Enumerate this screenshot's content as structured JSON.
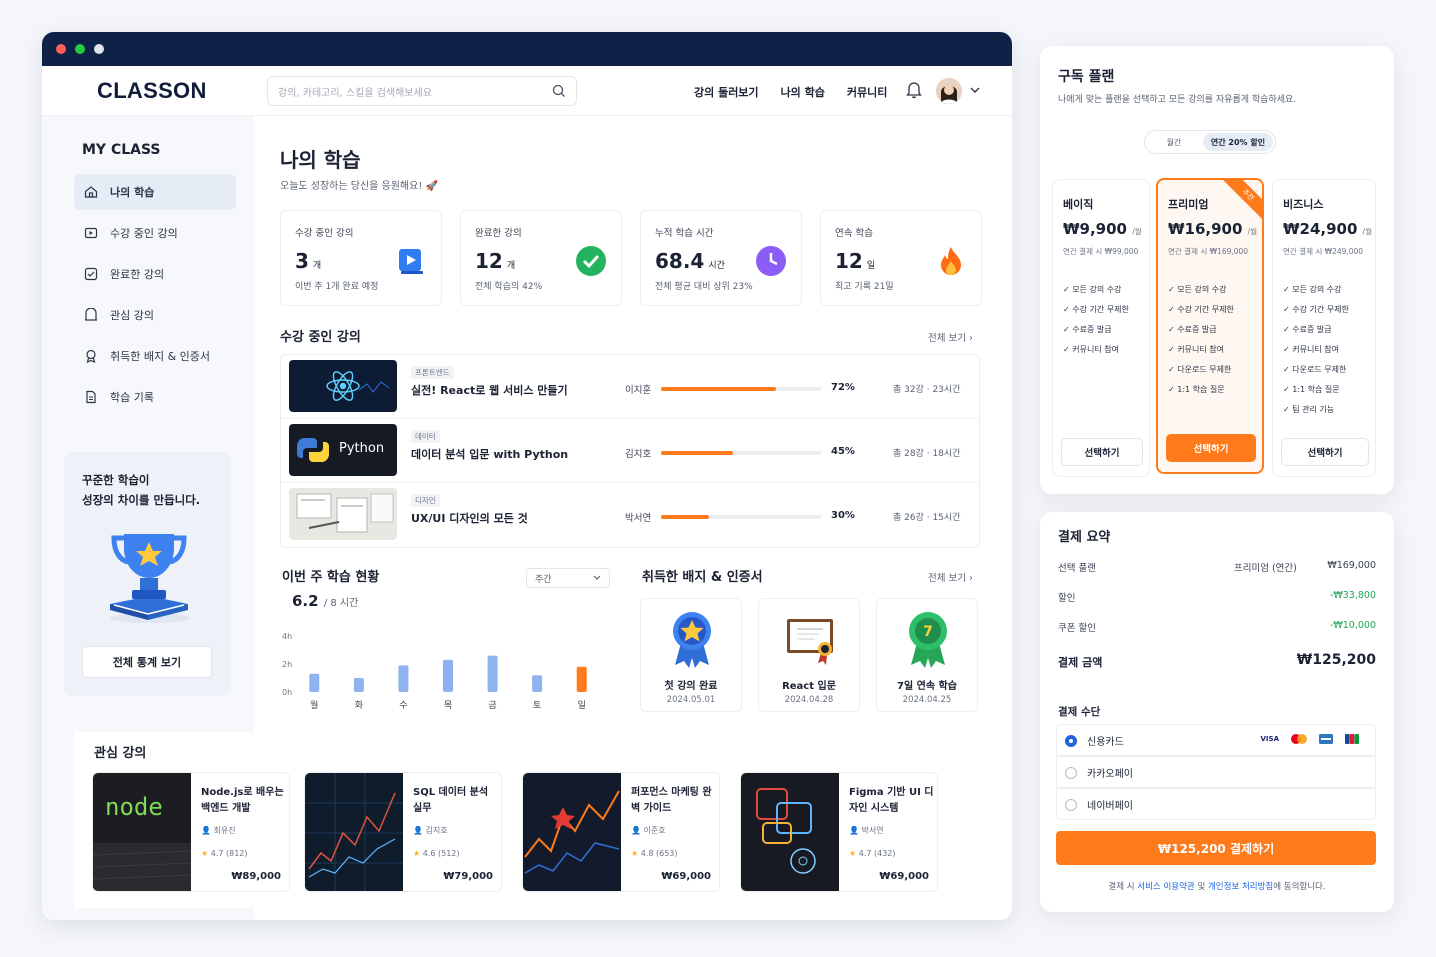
{
  "header": {
    "logo": "CLASSON",
    "search_placeholder": "강의, 카테고리, 스킬을 검색해보세요",
    "nav": [
      "강의 둘러보기",
      "나의 학습",
      "커뮤니티"
    ]
  },
  "sidebar": {
    "title": "MY CLASS",
    "items": [
      {
        "label": "나의 학습",
        "icon": "home-icon"
      },
      {
        "label": "수강 중인 강의",
        "icon": "play-icon"
      },
      {
        "label": "완료한 강의",
        "icon": "check-square-icon"
      },
      {
        "label": "관심 강의",
        "icon": "bookmark-icon"
      },
      {
        "label": "취득한 배지 & 인증서",
        "icon": "badge-icon"
      },
      {
        "label": "학습 기록",
        "icon": "document-icon"
      }
    ],
    "promo": {
      "line1": "꾸준한 학습이",
      "line2": "성장의 차이를 만듭니다.",
      "button": "전체 통계 보기"
    }
  },
  "main": {
    "title": "나의 학습",
    "subtitle": "오늘도 성장하는 당신을 응원해요! 🚀",
    "stats": [
      {
        "label": "수강 중인 강의",
        "value": "3",
        "unit": "개",
        "sub": "이번 주 1개 완료 예정"
      },
      {
        "label": "완료한 강의",
        "value": "12",
        "unit": "개",
        "sub": "전체 학습의 42%"
      },
      {
        "label": "누적 학습 시간",
        "value": "68.4",
        "unit": "시간",
        "sub": "전체 평균 대비 상위 23%"
      },
      {
        "label": "연속 학습",
        "value": "12",
        "unit": "일",
        "sub": "최고 기록 21일"
      }
    ],
    "courses_title": "수강 중인 강의",
    "see_all": "전체 보기",
    "courses": [
      {
        "category": "프론트엔드",
        "name": "실전! React로 웹 서비스 만들기",
        "instructor": "이지훈",
        "progress": 72,
        "progress_label": "72%",
        "total": "총 32강 · 23시간"
      },
      {
        "category": "데이터",
        "name": "데이터 분석 입문 with Python",
        "instructor": "김지호",
        "progress": 45,
        "progress_label": "45%",
        "total": "총 28강 · 18시간"
      },
      {
        "category": "디자인",
        "name": "UX/UI 디자인의 모든 것",
        "instructor": "박서연",
        "progress": 30,
        "progress_label": "30%",
        "total": "총 26강 · 15시간"
      }
    ],
    "python_thumb_label": "Python",
    "weekly": {
      "title": "이번 주 학습 현황",
      "period": "주간",
      "value": "6.2",
      "goal": "/ 8 시간"
    },
    "badges_title": "취득한 배지 & 인증서",
    "badges": [
      {
        "name": "첫 강의 완료",
        "date": "2024.05.01"
      },
      {
        "name": "React 입문",
        "date": "2024.04.28"
      },
      {
        "name": "7일 연속 학습",
        "date": "2024.04.25"
      }
    ],
    "fav_title": "관심 강의",
    "favorites": [
      {
        "title": "Node.js로 배우는 백엔드 개발",
        "instructor": "최유진",
        "rating": "4.7 (812)",
        "price": "₩89,000",
        "thumb_text": "node"
      },
      {
        "title": "SQL 데이터 분석 실무",
        "instructor": "김지호",
        "rating": "4.6 (512)",
        "price": "₩79,000"
      },
      {
        "title": "퍼포먼스 마케팅 완벽 가이드",
        "instructor": "이준호",
        "rating": "4.8 (653)",
        "price": "₩69,000"
      },
      {
        "title": "Figma 기반 UI 디자인 시스템",
        "instructor": "박서연",
        "rating": "4.7 (432)",
        "price": "₩69,000"
      }
    ]
  },
  "chart_data": {
    "type": "bar",
    "categories": [
      "월",
      "화",
      "수",
      "목",
      "금",
      "토",
      "일"
    ],
    "values": [
      1.3,
      1.0,
      1.9,
      2.3,
      2.6,
      1.2,
      1.8
    ],
    "ylim": [
      0,
      4
    ],
    "yticks": [
      "0h",
      "2h",
      "4h"
    ],
    "highlight_index": 6,
    "colors": {
      "normal": "#8fb2f0",
      "highlight": "#ff7a1a"
    }
  },
  "subscription": {
    "title": "구독 플랜",
    "subtitle": "나에게 맞는 플랜을 선택하고 모든 강의를 자유롭게 학습하세요.",
    "toggle": [
      "월간",
      "연간 20% 할인"
    ],
    "plans": [
      {
        "name": "베이직",
        "price": "₩9,900",
        "per": "/월",
        "annual": "연간 결제 시 ₩99,000",
        "features": [
          "모든 강의 수강",
          "수강 기간 무제한",
          "수료증 발급",
          "커뮤니티 참여"
        ],
        "button": "선택하기"
      },
      {
        "name": "프리미엄",
        "price": "₩16,900",
        "per": "/월",
        "annual": "연간 결제 시 ₩169,000",
        "features": [
          "모든 강의 수강",
          "수강 기간 무제한",
          "수료증 발급",
          "커뮤니티 참여",
          "다운로드 무제한",
          "1:1 학습 질문"
        ],
        "button": "선택하기",
        "ribbon": "추천"
      },
      {
        "name": "비즈니스",
        "price": "₩24,900",
        "per": "/월",
        "annual": "연간 결제 시 ₩249,000",
        "features": [
          "모든 강의 수강",
          "수강 기간 무제한",
          "수료증 발급",
          "커뮤니티 참여",
          "다운로드 무제한",
          "1:1 학습 질문",
          "팀 관리 기능"
        ],
        "button": "선택하기"
      }
    ]
  },
  "summary": {
    "title": "결제 요약",
    "rows": [
      {
        "label": "선택 플랜",
        "mid": "프리미엄 (연간)",
        "value": "₩169,000"
      },
      {
        "label": "할인",
        "mid": "",
        "value": "-₩33,800"
      },
      {
        "label": "쿠폰 할인",
        "mid": "",
        "value": "-₩10,000"
      }
    ],
    "total_label": "결제 금액",
    "total": "₩125,200",
    "method_title": "결제 수단",
    "methods": [
      "신용카드",
      "카카오페이",
      "네이버페이"
    ],
    "card_logos": [
      "VISA"
    ],
    "pay_button": "₩125,200 결제하기",
    "terms_prefix": "결제 시 ",
    "terms_link1": "서비스 이용약관",
    "terms_mid": " 및 ",
    "terms_link2": "개인정보 처리방침",
    "terms_suffix": "에 동의합니다."
  }
}
